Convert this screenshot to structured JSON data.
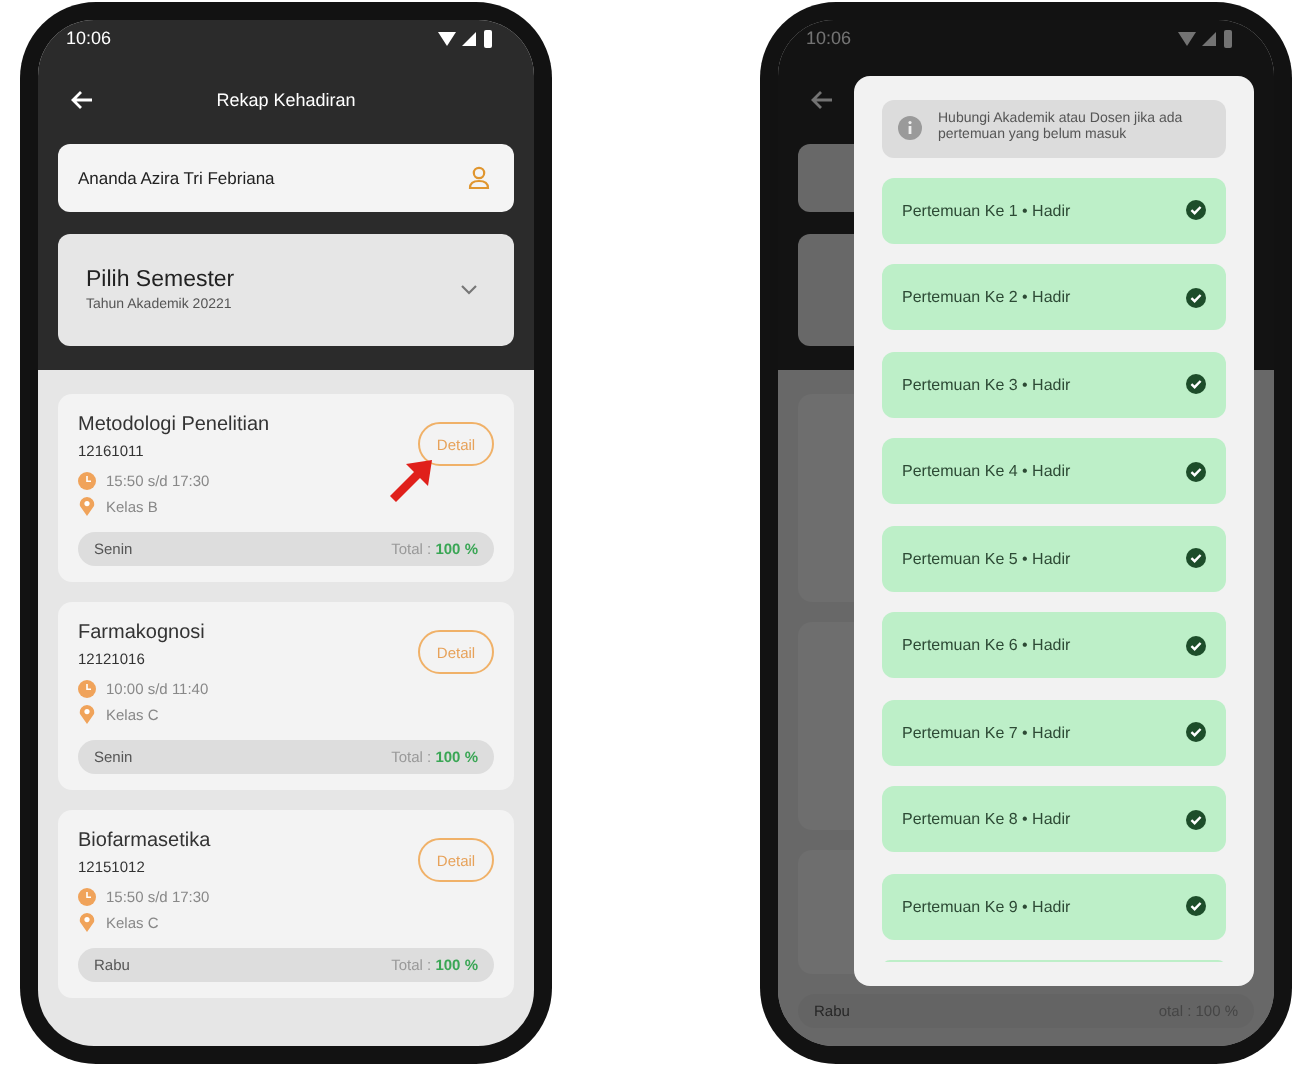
{
  "list_screen": {
    "status_time": "10:06",
    "title": "Rekap Kehadiran",
    "student_name": "Ananda Azira Tri Febriana",
    "semester": {
      "title": "Pilih Semester",
      "subtitle": "Tahun Akademik 20221"
    },
    "courses": [
      {
        "name": "Metodologi Penelitian",
        "code": "12161011",
        "time": "15:50 s/d 17:30",
        "room": "Kelas B",
        "day": "Senin",
        "total_label": "Total :",
        "total_value": "100 %",
        "button": "Detail",
        "pointed": true
      },
      {
        "name": "Farmakognosi",
        "code": "12121016",
        "time": "10:00 s/d 11:40",
        "room": "Kelas C",
        "day": "Senin",
        "total_label": "Total :",
        "total_value": "100 %",
        "button": "Detail",
        "pointed": false
      },
      {
        "name": "Biofarmasetika",
        "code": "12151012",
        "time": "15:50 s/d 17:30",
        "room": "Kelas C",
        "day": "Rabu",
        "total_label": "Total :",
        "total_value": "100 %",
        "button": "Detail",
        "pointed": false
      }
    ]
  },
  "detail_screen": {
    "status_time": "10:06",
    "notice": "Hubungi Akademik atau Dosen jika ada pertemuan yang belum masuk",
    "meetings": [
      {
        "label": "Pertemuan Ke 1 • Hadir",
        "checked": true
      },
      {
        "label": "Pertemuan Ke 2 • Hadir",
        "checked": true
      },
      {
        "label": "Pertemuan Ke 3 • Hadir",
        "checked": true
      },
      {
        "label": "Pertemuan Ke 4 • Hadir",
        "checked": true
      },
      {
        "label": "Pertemuan Ke 5 • Hadir",
        "checked": true
      },
      {
        "label": "Pertemuan Ke 6 • Hadir",
        "checked": true
      },
      {
        "label": "Pertemuan Ke 7 • Hadir",
        "checked": true
      },
      {
        "label": "Pertemuan Ke 8 • Hadir",
        "checked": true
      },
      {
        "label": "Pertemuan Ke 9 • Hadir",
        "checked": true
      }
    ],
    "background_footer": {
      "day": "Rabu",
      "total": "otal : 100 %"
    }
  }
}
